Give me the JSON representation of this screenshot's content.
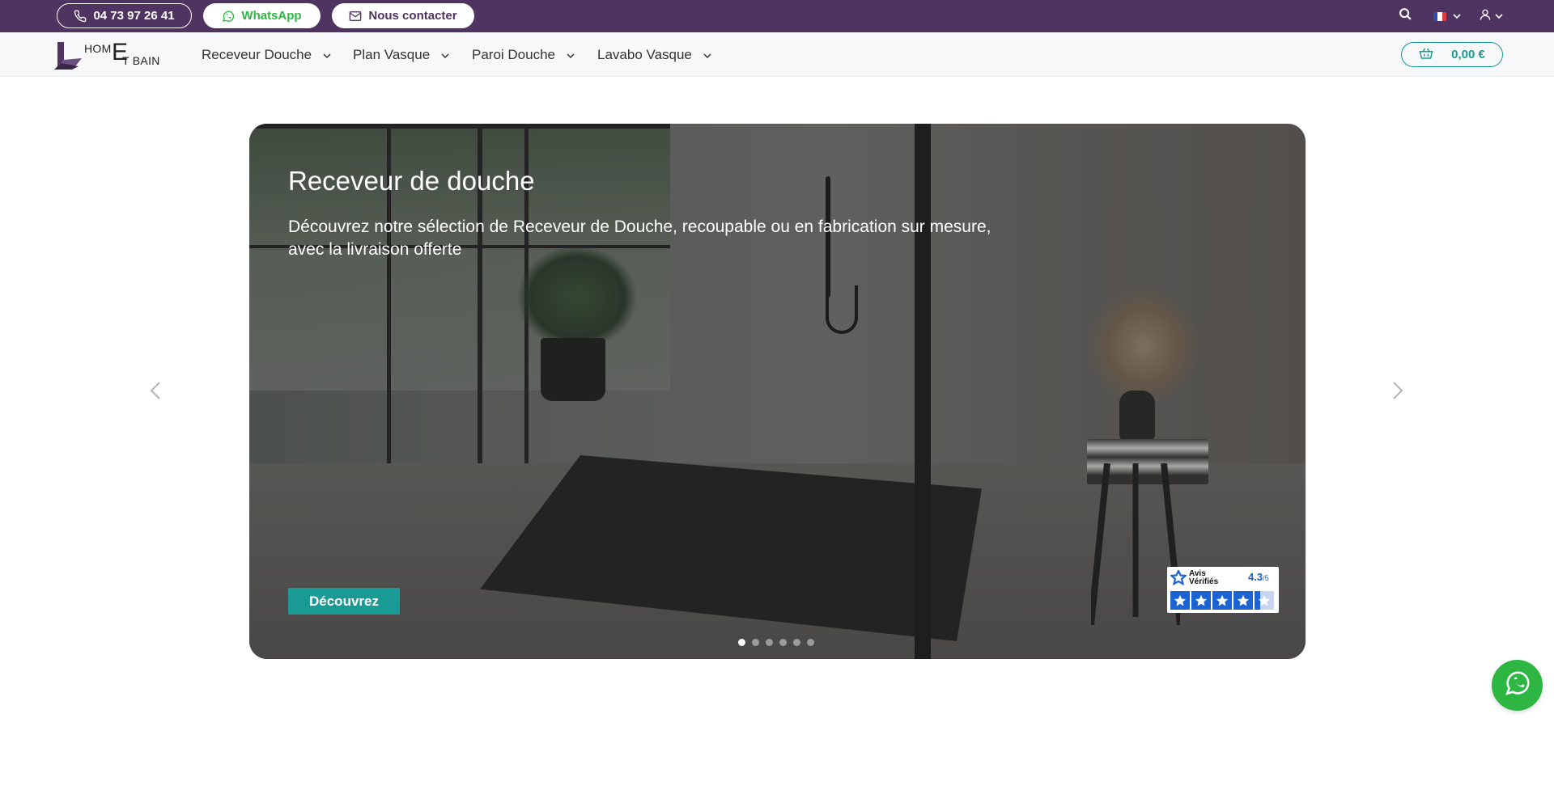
{
  "topbar": {
    "phone_label": "04 73 97 26 41",
    "whatsapp_label": "WhatsApp",
    "contact_label": "Nous contacter",
    "language": "fr",
    "colors": {
      "background": "#4f3461",
      "whatsapp": "#2db742"
    }
  },
  "nav": {
    "logo": {
      "part1": "HOM",
      "part2": "E",
      "part3": "T BAIN"
    },
    "items": [
      {
        "label": "Receveur Douche"
      },
      {
        "label": "Plan Vasque"
      },
      {
        "label": "Paroi Douche"
      },
      {
        "label": "Lavabo Vasque"
      }
    ],
    "cart_total": "0,00 €",
    "accent_color": "#1a9a94"
  },
  "hero": {
    "title": "Receveur de douche",
    "description": "Découvrez notre sélection de Receveur de Douche, recoupable ou en fabrication sur mesure, avec la livraison offerte",
    "cta_label": "Découvrez",
    "slides_count": 6,
    "active_slide": 1
  },
  "reviews_badge": {
    "title_line1": "Avis",
    "title_line2": "Vérifiés",
    "score": "4.3",
    "score_suffix": "/5",
    "rating_fraction": 0.86
  },
  "icons": {
    "phone": "phone-icon",
    "whatsapp": "whatsapp-icon",
    "mail": "mail-icon",
    "search": "search-icon",
    "user": "user-icon",
    "cart": "cart-icon",
    "prev": "chevron-left-icon",
    "next": "chevron-right-icon"
  }
}
